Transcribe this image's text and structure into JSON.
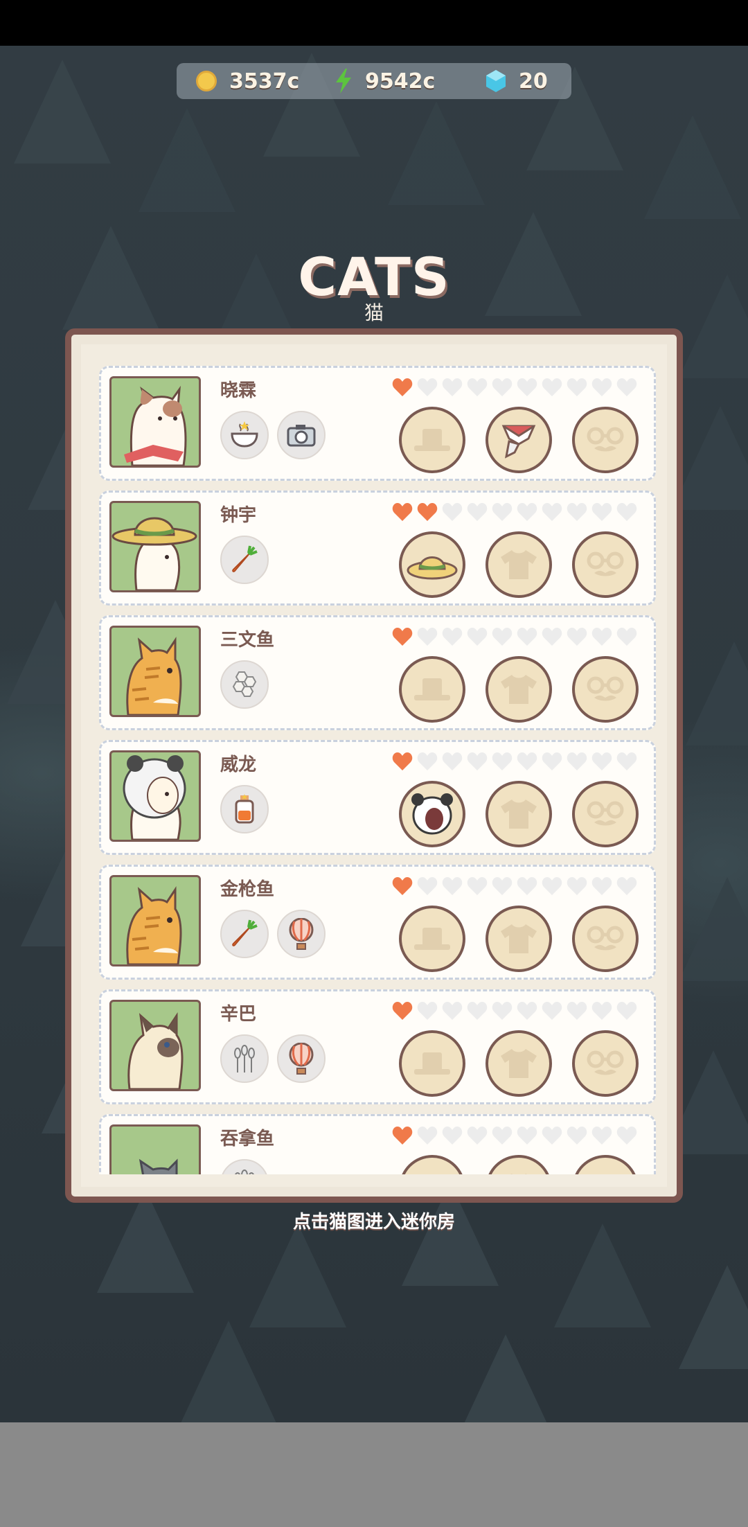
{
  "currency": {
    "coins": "3537c",
    "energy": "9542c",
    "gems": "20",
    "coin_icon": "gold-coin",
    "energy_icon": "green-lightning-bolt",
    "gem_icon": "blue-gem"
  },
  "header": {
    "title": "CATS",
    "subtitle": "猫"
  },
  "cats": [
    {
      "name": "晓霖",
      "hearts": 1,
      "max_hearts": 10,
      "badges": [
        "soup-bowl-icon",
        "camera-icon"
      ],
      "portrait": "calico-cat-scarf",
      "slots": [
        "hat-empty",
        "scarf-equipped",
        "glasses-empty"
      ]
    },
    {
      "name": "钟宇",
      "hearts": 2,
      "max_hearts": 10,
      "badges": [
        "carrot-icon"
      ],
      "portrait": "white-cat-straw-hat",
      "slots": [
        "straw-hat-equipped",
        "shirt-empty",
        "glasses-empty"
      ]
    },
    {
      "name": "三文鱼",
      "hearts": 1,
      "max_hearts": 10,
      "badges": [
        "honeycomb-icon"
      ],
      "portrait": "orange-tabby-cat",
      "slots": [
        "hat-empty",
        "shirt-empty",
        "glasses-empty"
      ]
    },
    {
      "name": "威龙",
      "hearts": 1,
      "max_hearts": 10,
      "badges": [
        "juice-bottle-icon"
      ],
      "portrait": "white-cat-hood",
      "slots": [
        "panda-hood-equipped",
        "shirt-empty",
        "glasses-empty"
      ]
    },
    {
      "name": "金枪鱼",
      "hearts": 1,
      "max_hearts": 10,
      "badges": [
        "carrot-icon",
        "hot-air-balloon-icon"
      ],
      "portrait": "orange-tabby-cat",
      "slots": [
        "hat-empty",
        "shirt-empty",
        "glasses-empty"
      ]
    },
    {
      "name": "辛巴",
      "hearts": 1,
      "max_hearts": 10,
      "badges": [
        "wheat-icon",
        "hot-air-balloon-icon"
      ],
      "portrait": "siamese-cat",
      "slots": [
        "hat-empty",
        "shirt-empty",
        "glasses-empty"
      ]
    },
    {
      "name": "吞拿鱼",
      "hearts": 1,
      "max_hearts": 10,
      "badges": [
        "wheat-icon"
      ],
      "portrait": "gray-cat",
      "slots": [
        "hat-empty",
        "shirt-empty",
        "glasses-empty"
      ]
    }
  ],
  "hint": "点击猫图进入迷你房",
  "colors": {
    "heart_filled": "#f07a4a",
    "heart_empty": "#ececec",
    "portrait_bg": "#a7c88a",
    "panel_border": "#7d5650"
  }
}
